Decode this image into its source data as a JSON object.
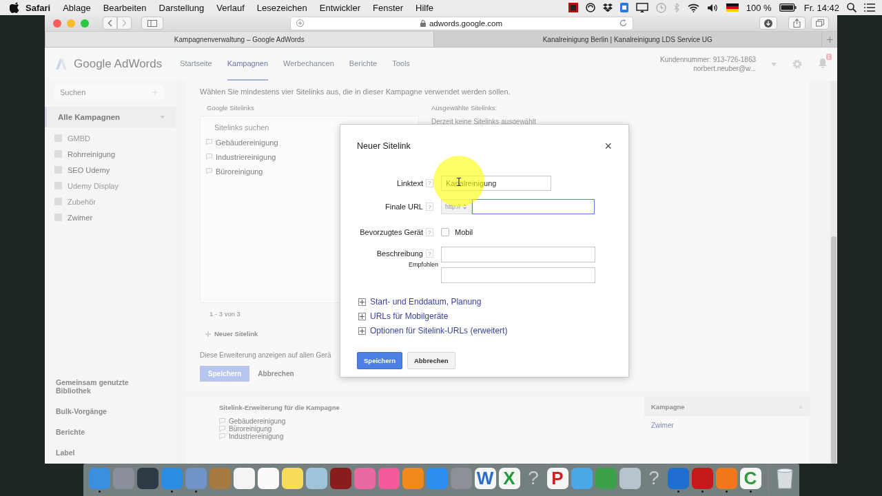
{
  "menu_bar": {
    "app": "Safari",
    "menus": [
      "Ablage",
      "Bearbeiten",
      "Darstellung",
      "Verlauf",
      "Lesezeichen",
      "Entwickler",
      "Fenster",
      "Hilfe"
    ],
    "battery": "100 %",
    "clock": "Fr. 14:42"
  },
  "browser": {
    "address": "adwords.google.com",
    "tabs": [
      {
        "label": "Kampagnenverwaltung – Google AdWords",
        "selected": true
      },
      {
        "label": "Kanalreinigung Berlin | Kanalreinigung LDS Service UG",
        "selected": false
      }
    ]
  },
  "adwords": {
    "logo": "Google AdWords",
    "nav": [
      {
        "label": "Startseite",
        "selected": false
      },
      {
        "label": "Kampagnen",
        "selected": true
      },
      {
        "label": "Werbechancen",
        "selected": false
      },
      {
        "label": "Berichte",
        "selected": false
      },
      {
        "label": "Tools",
        "selected": false
      }
    ],
    "account_line_1": "Kundennummer: 913-726-1863",
    "account_line_2": "norbert.neuber@w...",
    "notification_count": "1"
  },
  "sidebar": {
    "search_placeholder": "Suchen",
    "all_campaigns": "Alle Kampagnen",
    "campaigns": [
      {
        "label": "GMBD",
        "active": false
      },
      {
        "label": "Rohrreinigung",
        "active": true
      },
      {
        "label": "SEO Udemy",
        "active": true
      },
      {
        "label": "Udemy Display",
        "active": false
      },
      {
        "label": "Zubehör",
        "active": false
      },
      {
        "label": "Zwimer",
        "active": true
      }
    ],
    "links": [
      "Gemeinsam genutzte Bibliothek",
      "Bulk-Vorgänge",
      "Berichte",
      "Label"
    ]
  },
  "sitelinks_panel": {
    "instruction": "Wählen Sie mindestens vier Sitelinks aus, die in dieser Kampagne verwendet werden sollen.",
    "google_sitelinks_title": "Google Sitelinks",
    "search_placeholder": "Sitelinks suchen",
    "items": [
      "Gebäudereinigung",
      "Industriereinigung",
      "Büroreinigung"
    ],
    "pager": "1 - 3 von 3",
    "new_sitelink": "Neuer Sitelink",
    "selected_title": "Ausgewählte Sitelinks:",
    "selected_empty": "Derzeit keine Sitelinks ausgewählt",
    "devices_text": "Diese Erweiterung anzeigen auf allen Gerä",
    "buttons": [
      "Speichern",
      "Abbrechen"
    ]
  },
  "table": {
    "columns": [
      "Sitelink-Erweiterung für die Kampagne",
      "Kampagne"
    ],
    "rows": [
      {
        "sitelinks": [
          "Gebäudereinigung",
          "Büroreinigung",
          "Industriereinigung"
        ],
        "campaign": "Zwimer"
      }
    ]
  },
  "dialog": {
    "title": "Neuer Sitelink",
    "close": "×",
    "linktext": {
      "label": "Linktext",
      "help": "?",
      "value": "Kanalreinigung"
    },
    "final_url": {
      "label": "Finale URL",
      "help": "?",
      "protocol": "http://",
      "focused": true
    },
    "device": {
      "label": "Bevorzugtes Gerät",
      "help": "?",
      "option": "Mobil",
      "checked": false
    },
    "description": {
      "label": "Beschreibung",
      "help": "?",
      "note": "Empfohlen"
    },
    "expanders": [
      {
        "label": "Start- und Enddatum, Planung",
        "expanded": false
      },
      {
        "label": "URLs für Mobilgeräte",
        "expanded": false
      },
      {
        "label": "Optionen für Sitelink-URLs (erweitert)",
        "expanded": false
      }
    ],
    "buttons": [
      {
        "label": "Speichern",
        "kind": "primary"
      },
      {
        "label": "Abbrechen",
        "kind": "secondary"
      }
    ]
  },
  "dock": [
    {
      "kind": "tile",
      "color": "#3b8fe0",
      "running": true
    },
    {
      "kind": "tile",
      "color": "#8a8f99",
      "running": false
    },
    {
      "kind": "tile",
      "color": "#2e3a44",
      "running": false
    },
    {
      "kind": "tile",
      "color": "#2a8de0",
      "running": true
    },
    {
      "kind": "tile",
      "color": "#6f95c8",
      "running": true
    },
    {
      "kind": "tile",
      "color": "#a67a43",
      "running": false
    },
    {
      "kind": "tile",
      "color": "#f4f4f4",
      "running": false
    },
    {
      "kind": "tile",
      "color": "#fafafa",
      "running": false
    },
    {
      "kind": "tile",
      "color": "#f6dc5a",
      "running": false
    },
    {
      "kind": "tile",
      "color": "#9fc3d9",
      "running": false
    },
    {
      "kind": "tile",
      "color": "#8a1c1c",
      "running": false
    },
    {
      "kind": "tile",
      "color": "#e96aa0",
      "running": false
    },
    {
      "kind": "tile",
      "color": "#f25a9a",
      "running": false
    },
    {
      "kind": "tile",
      "color": "#f08a1c",
      "running": false
    },
    {
      "kind": "tile",
      "color": "#2b8ef0",
      "running": false
    },
    {
      "kind": "tile",
      "color": "#8d9096",
      "running": false
    },
    {
      "kind": "letter",
      "label": "W",
      "color": "#2a6cc8",
      "running": false
    },
    {
      "kind": "letter",
      "label": "X",
      "color": "#1f9a3a",
      "running": false
    },
    {
      "kind": "letter",
      "label": "?",
      "color": "#c8ccd0",
      "running": false
    },
    {
      "kind": "letter",
      "label": "P",
      "color": "#d42020",
      "running": false
    },
    {
      "kind": "tile",
      "color": "#4aa8e8",
      "running": false
    },
    {
      "kind": "tile",
      "color": "#3ca04a",
      "running": false
    },
    {
      "kind": "tile",
      "color": "#b8c4cc",
      "running": false
    },
    {
      "kind": "letter",
      "label": "?",
      "color": "#c8ccd0",
      "running": false
    },
    {
      "kind": "tile",
      "color": "#1f6fd0",
      "running": true
    },
    {
      "kind": "tile",
      "color": "#c41a1a",
      "running": true
    },
    {
      "kind": "tile",
      "color": "#f07a1a",
      "running": true
    },
    {
      "kind": "letter",
      "label": "C",
      "color": "#2f9a3e",
      "running": true
    },
    {
      "kind": "trash",
      "color": "#d8dde2",
      "running": false
    }
  ]
}
